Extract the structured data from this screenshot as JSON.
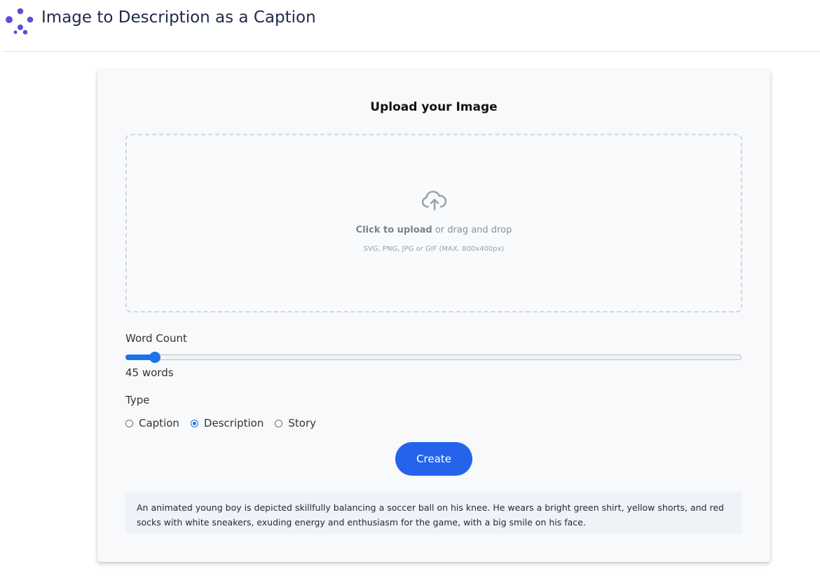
{
  "header": {
    "title": "Image to Description as a Caption",
    "logo_icon": "molecule-dots-logo",
    "brand_color": "#5b50d6"
  },
  "upload": {
    "heading": "Upload your Image",
    "icon": "cloud-upload-icon",
    "click_label": "Click to upload",
    "drag_label": " or drag and drop",
    "hint": "SVG, PNG, JPG or GIF (MAX. 800x400px)"
  },
  "word_count": {
    "label": "Word Count",
    "value_text": "45 words",
    "value": 45,
    "slider_fraction": 0.048
  },
  "type": {
    "label": "Type",
    "options": [
      {
        "label": "Caption",
        "checked": false
      },
      {
        "label": "Description",
        "checked": true
      },
      {
        "label": "Story",
        "checked": false
      }
    ]
  },
  "actions": {
    "create_label": "Create"
  },
  "result": {
    "text": "An animated young boy is depicted skillfully balancing a soccer ball on his knee. He wears a bright green shirt, yellow shorts, and red socks with white sneakers, exuding energy and enthusiasm for the game, with a big smile on his face."
  },
  "colors": {
    "accent": "#1a73e8",
    "button": "#2563eb"
  }
}
